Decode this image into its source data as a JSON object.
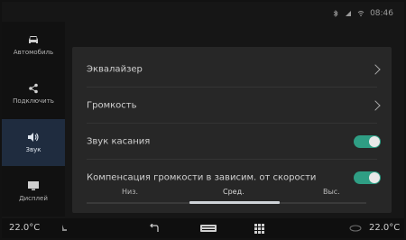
{
  "status": {
    "time": "08:46"
  },
  "sidebar": {
    "items": [
      {
        "label": "Автомобиль",
        "icon": "car-icon"
      },
      {
        "label": "Подключить",
        "icon": "share-icon"
      },
      {
        "label": "Звук",
        "icon": "speaker-icon",
        "active": true
      },
      {
        "label": "Дисплей",
        "icon": "display-icon"
      }
    ]
  },
  "settings": {
    "equalizer": "Эквалайзер",
    "volume": "Громкость",
    "touch_sound": "Звук касания",
    "speed_comp": "Компенсация громкости в зависим. от скорости",
    "levels": [
      "Низ.",
      "Сред.",
      "Выс."
    ],
    "selected_level": "Сред."
  },
  "bottombar": {
    "temp_left": "22.0°C",
    "temp_right": "22.0°C"
  },
  "colors": {
    "accent": "#2f9e84",
    "active_side": "#1f2c3f",
    "panel": "#272727"
  }
}
